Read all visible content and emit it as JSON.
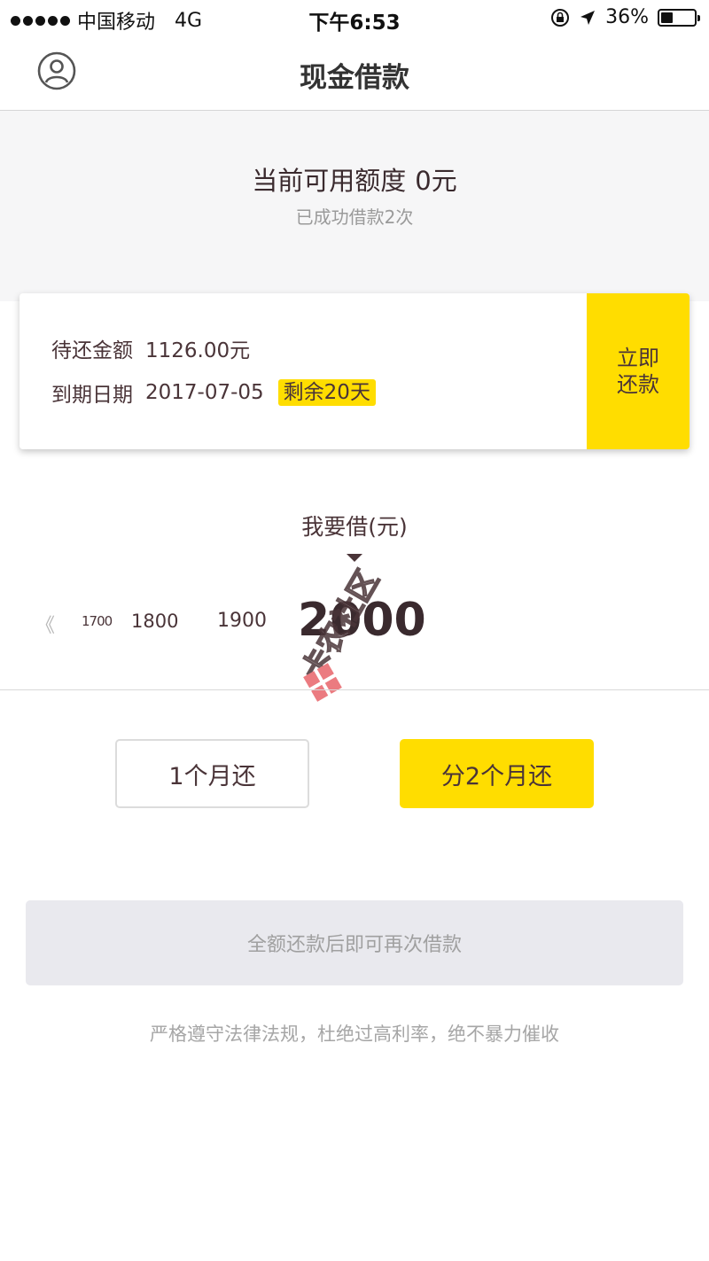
{
  "status_bar": {
    "carrier": "中国移动",
    "network": "4G",
    "time": "下午6:53",
    "battery_percent": "36%",
    "battery_level": 0.36,
    "icons": [
      "signal-dots-icon",
      "orientation-lock-icon",
      "location-arrow-icon",
      "battery-icon"
    ]
  },
  "nav": {
    "title": "现金借款",
    "profile_icon": "user-profile-icon"
  },
  "summary": {
    "credit_label": "当前可用额度",
    "credit_amount": "0元",
    "loan_count": "已成功借款2次"
  },
  "repayment": {
    "amount_label": "待还金额",
    "amount_value": "1126.00元",
    "due_label": "到期日期",
    "due_value": "2017-07-05",
    "remaining_badge": "剩余20天",
    "repay_button_line1": "立即",
    "repay_button_line2": "还款"
  },
  "borrow": {
    "label": "我要借(元)",
    "scale_values": [
      "1700",
      "1800",
      "1900",
      "2000"
    ],
    "selected_value": "2000",
    "left_arrow": "《"
  },
  "terms": {
    "option_1": "1个月还",
    "option_2": "分2个月还",
    "selected": "分2个月还"
  },
  "submit": {
    "label": "全额还款后即可再次借款",
    "enabled": false
  },
  "footer": {
    "note": "严格遵守法律法规，杜绝过高利率，绝不暴力催收"
  },
  "watermark": {
    "text": "卡农社区"
  },
  "colors": {
    "accent_yellow": "#ffdd00",
    "text_dark": "#4a3438",
    "summary_bg": "#f6f6f7",
    "disabled_bg": "#e9e9ee"
  }
}
